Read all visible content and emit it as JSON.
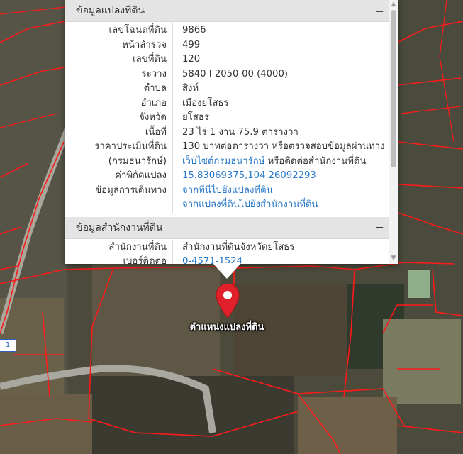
{
  "colors": {
    "accent": "#2878c9",
    "marker": "#e0212b",
    "parcel_line": "#ff1a1a"
  },
  "sections": {
    "land": {
      "title": "ข้อมูลแปลงที่ดิน",
      "toggle": "−",
      "rows": [
        {
          "label": "เลขโฉนดที่ดิน",
          "value": "9866"
        },
        {
          "label": "หน้าสำรวจ",
          "value": "499"
        },
        {
          "label": "เลขที่ดิน",
          "value": "120"
        },
        {
          "label": "ระวาง",
          "value": "5840 I 2050-00 (4000)"
        },
        {
          "label": "ตำบล",
          "value": "สิงห์"
        },
        {
          "label": "อำเภอ",
          "value": "เมืองยโสธร"
        },
        {
          "label": "จังหวัด",
          "value": "ยโสธร"
        },
        {
          "label": "เนื้อที่",
          "value": "23 ไร่ 1 งาน 75.9 ตารางวา"
        }
      ],
      "price": {
        "label1": "ราคาประเมินที่ดิน",
        "label2": "(กรมธนารักษ์)",
        "line1": "130 บาทต่อตารางวา หรือตรวจสอบข้อมูลผ่านทาง",
        "link": "เว็บไซต์กรมธนารักษ์",
        "line2_suffix": " หรือติดต่อสำนักงานที่ดิน"
      },
      "coords": {
        "label": "ค่าพิกัดแปลง",
        "value": "15.83069375,104.26092293"
      },
      "travel": {
        "label": "ข้อมูลการเดินทาง",
        "to_parcel": "จากที่นี่ไปยังแปลงที่ดิน",
        "to_office": "จากแปลงที่ดินไปยังสำนักงานที่ดิน"
      }
    },
    "office": {
      "title": "ข้อมูลสำนักงานที่ดิน",
      "toggle": "−",
      "office_label": "สำนักงานที่ดิน",
      "office_value": "สำนักงานที่ดินจังหวัดยโสธร",
      "phone_label": "เบอร์ติดต่อ",
      "phone_value": "0-4571-1524"
    }
  },
  "marker": {
    "label": "ตำแหน่งแปลงที่ดิน",
    "icon": "map-pin-icon"
  },
  "map_tag": "1"
}
